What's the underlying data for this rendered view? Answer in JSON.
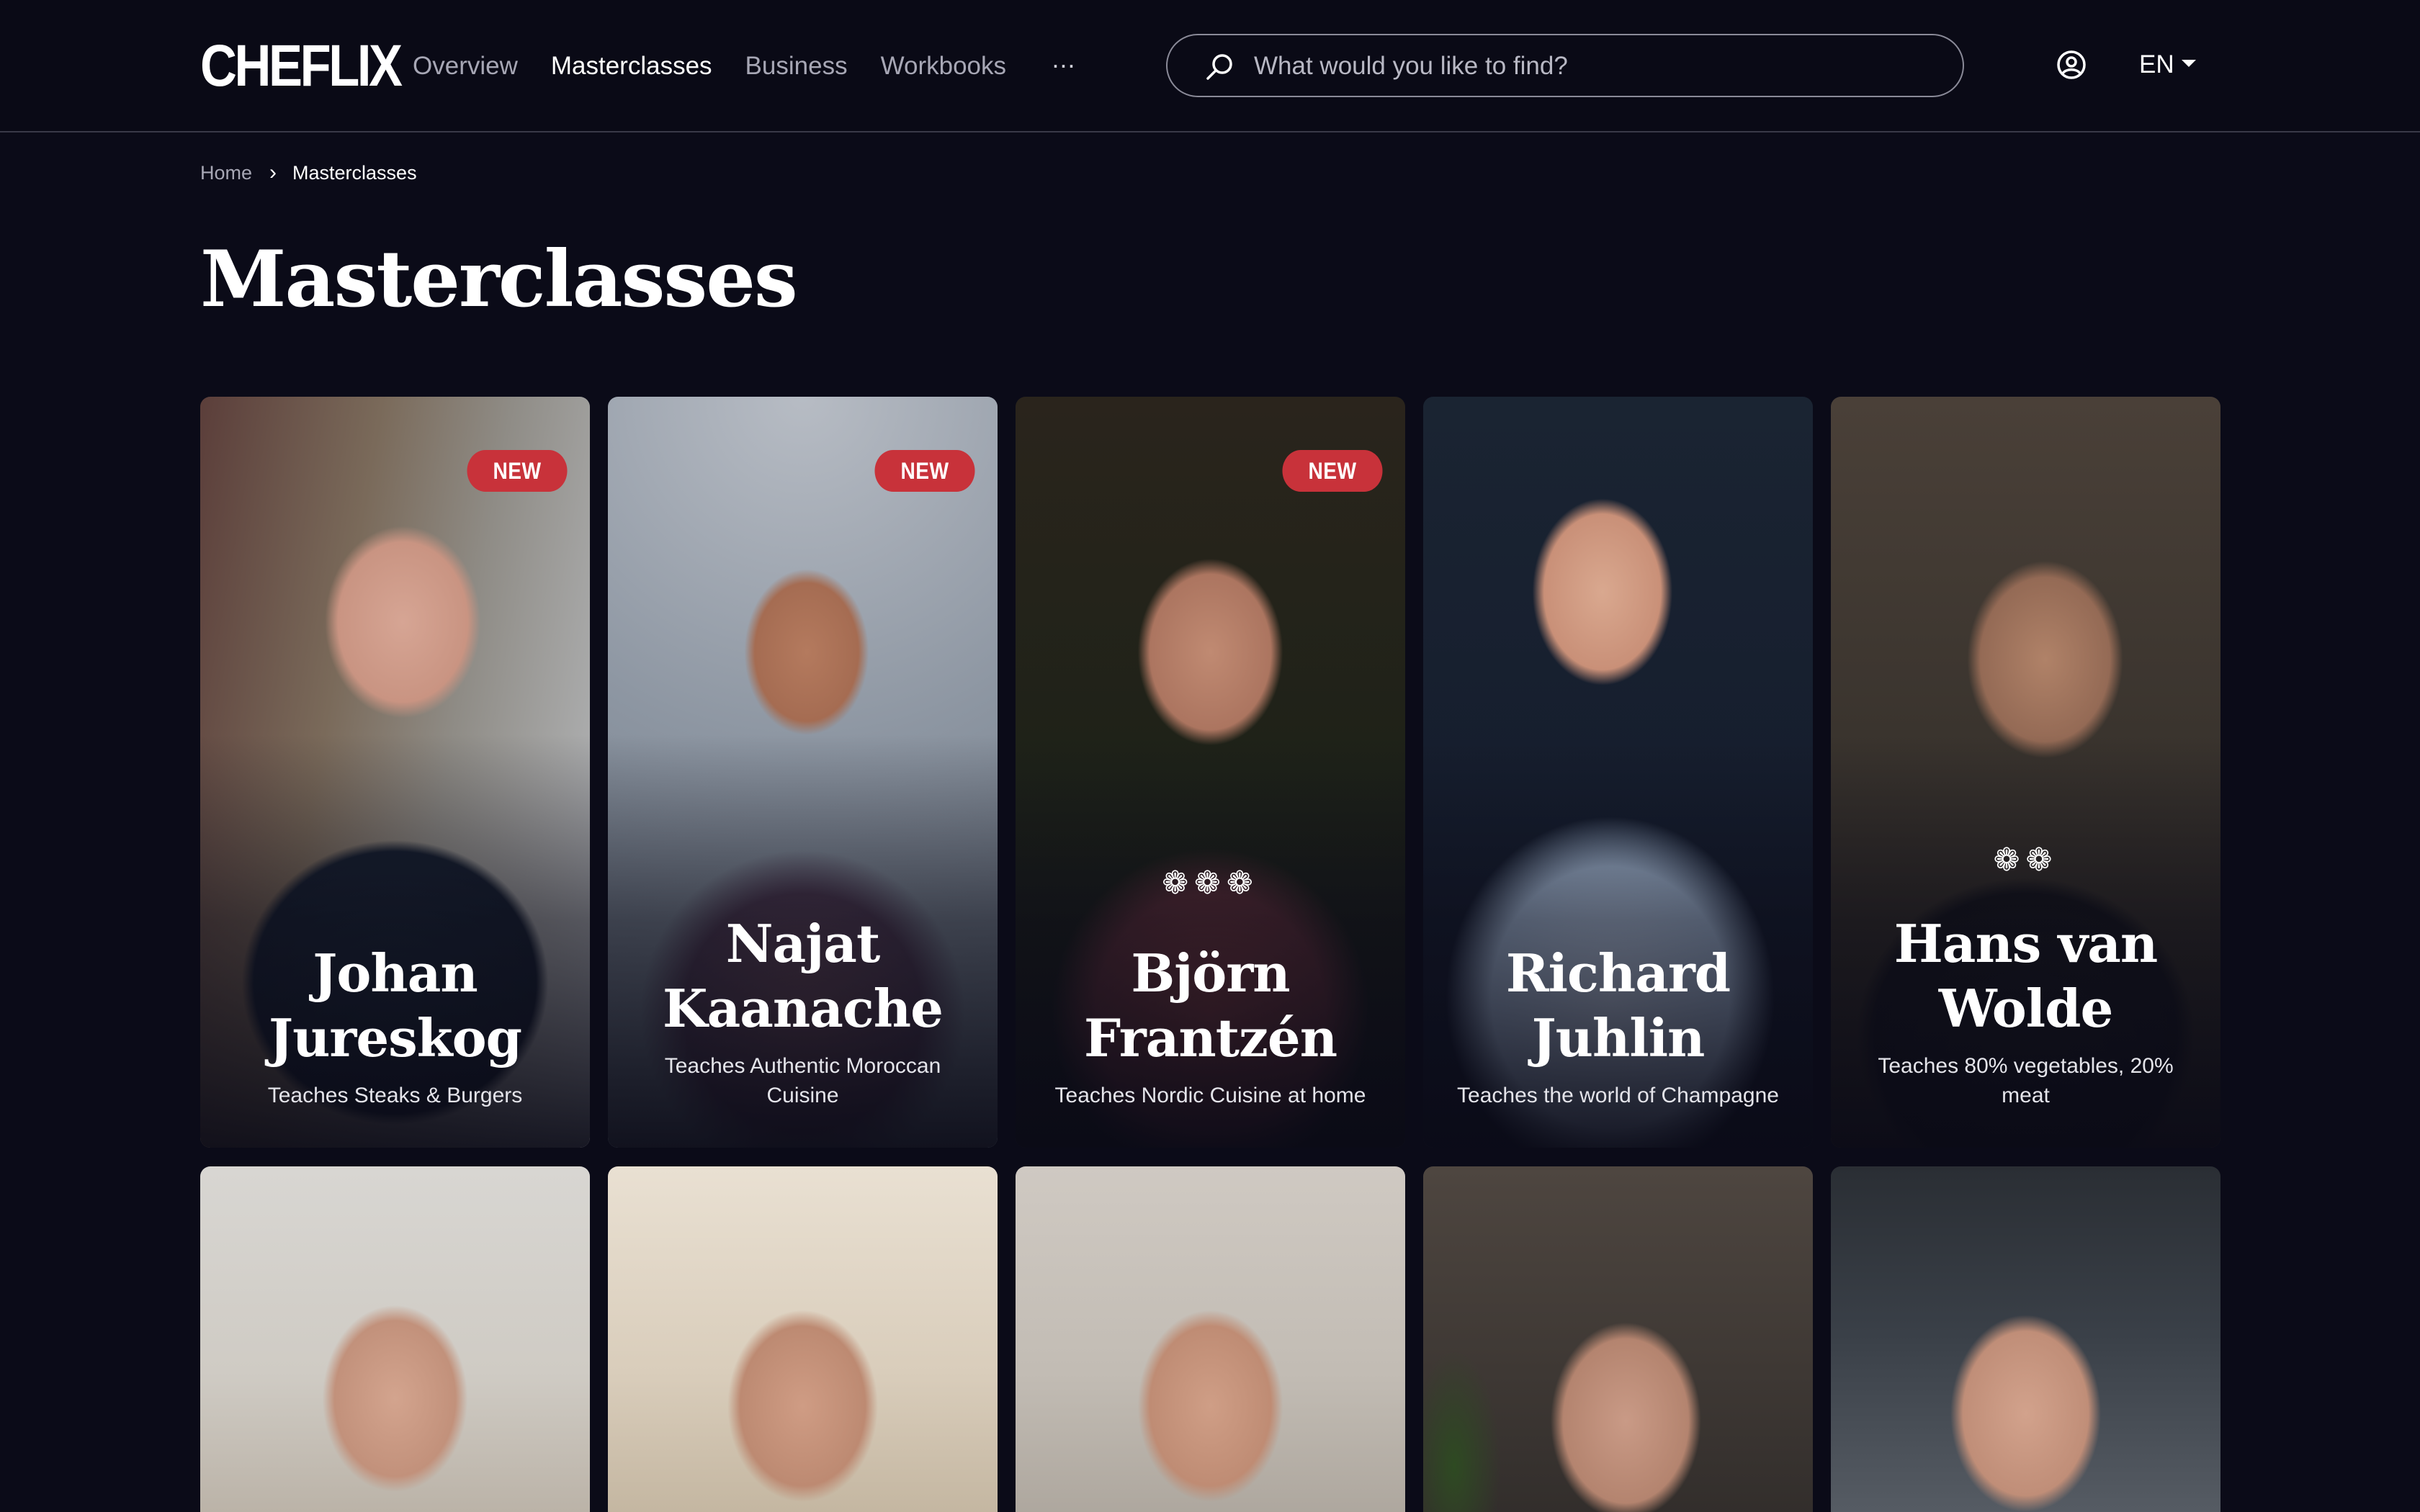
{
  "header": {
    "logo": "CHEFLIX",
    "nav": [
      "Overview",
      "Masterclasses",
      "Business",
      "Workbooks"
    ],
    "more": "···",
    "search_placeholder": "What would you like to find?",
    "language": "EN"
  },
  "breadcrumb": {
    "home": "Home",
    "separator": "›",
    "current": "Masterclasses"
  },
  "page_title": "Masterclasses",
  "cards": [
    {
      "name": "Johan Jureskog",
      "desc": "Teaches Steaks & Burgers",
      "badge": "NEW",
      "stars": ""
    },
    {
      "name": "Najat Kaanache",
      "desc": "Teaches Authentic Moroccan Cuisine",
      "badge": "NEW",
      "stars": ""
    },
    {
      "name": "Björn Frantzén",
      "desc": "Teaches Nordic Cuisine at home",
      "badge": "NEW",
      "stars": "❁❁❁"
    },
    {
      "name": "Richard Juhlin",
      "desc": "Teaches the world of Champagne",
      "badge": "",
      "stars": ""
    },
    {
      "name": "Hans van Wolde",
      "desc": "Teaches 80% vegetables, 20% meat",
      "badge": "",
      "stars": "❁❁"
    }
  ],
  "colors": {
    "background": "#0b0b18",
    "badge": "#c8323a",
    "nav_inactive": "#a7a7b5"
  }
}
